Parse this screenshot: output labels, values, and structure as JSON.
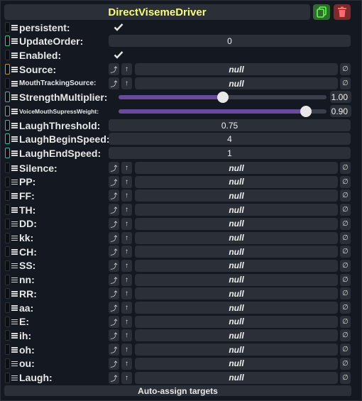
{
  "header": {
    "title": "DirectVisemeDriver"
  },
  "fields": {
    "persistent": {
      "label": "persistent:"
    },
    "update_order": {
      "label": "UpdateOrder:",
      "value": "0"
    },
    "enabled": {
      "label": "Enabled:"
    },
    "source": {
      "label": "Source:",
      "value": "null"
    },
    "mouth_tracking_source": {
      "label": "MouthTrackingSource:",
      "value": "null"
    },
    "strength_multiplier": {
      "label": "StrengthMultiplier:",
      "value": "1.00",
      "level": 0.5
    },
    "voice_mouth_supress_weight": {
      "label": "VoiceMouthSupressWeight:",
      "value": "0.90",
      "level": 0.9
    },
    "laugh_threshold": {
      "label": "LaughThreshold:",
      "value": "0.75"
    },
    "laugh_begin_speed": {
      "label": "LaughBeginSpeed:",
      "value": "4"
    },
    "laugh_end_speed": {
      "label": "LaughEndSpeed:",
      "value": "1"
    }
  },
  "visemes": [
    {
      "label": "Silence:",
      "value": "null"
    },
    {
      "label": "PP:",
      "value": "null"
    },
    {
      "label": "FF:",
      "value": "null"
    },
    {
      "label": "TH:",
      "value": "null"
    },
    {
      "label": "DD:",
      "value": "null"
    },
    {
      "label": "kk:",
      "value": "null"
    },
    {
      "label": "CH:",
      "value": "null"
    },
    {
      "label": "SS:",
      "value": "null"
    },
    {
      "label": "nn:",
      "value": "null"
    },
    {
      "label": "RR:",
      "value": "null"
    },
    {
      "label": "aa:",
      "value": "null"
    },
    {
      "label": "E:",
      "value": "null"
    },
    {
      "label": "ih:",
      "value": "null"
    },
    {
      "label": "oh:",
      "value": "null"
    },
    {
      "label": "ou:",
      "value": "null"
    },
    {
      "label": "Laugh:",
      "value": "null"
    }
  ],
  "footer": {
    "button_label": "Auto-assign targets"
  },
  "colors": {
    "title": "#f7ff7a",
    "slider_fill": "#6a4a9c",
    "duplicate_button": "#2f6b2c",
    "delete_button": "#7b2a2e",
    "connector_green": "#3fc86a",
    "connector_orange": "#c8903f",
    "connector_teal": "#3fb8a8"
  },
  "icons": {
    "duplicate": "duplicate-icon",
    "delete": "trash-icon",
    "check": "checkmark-icon",
    "jump": "jump-to-icon",
    "up": "arrow-up-icon",
    "clear": "null-clear-icon"
  }
}
